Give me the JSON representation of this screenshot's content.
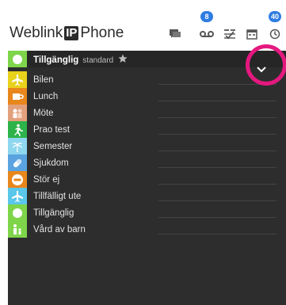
{
  "app": {
    "brand_prefix": "Weblink",
    "brand_ip": "IP",
    "brand_suffix": "Phone"
  },
  "header": {
    "icons": [
      {
        "name": "chat-icon",
        "badge": ""
      },
      {
        "name": "voicemail-icon",
        "badge": "8"
      },
      {
        "name": "call-log-icon",
        "badge": ""
      },
      {
        "name": "calendar-icon",
        "badge": ""
      },
      {
        "name": "clock-icon",
        "badge": "40"
      }
    ]
  },
  "status": {
    "current_label": "Tillgänglig",
    "current_sub": "standard",
    "items": [
      {
        "label": "Bilen",
        "color": "#e8d21c",
        "icon": "airplane-icon"
      },
      {
        "label": "Lunch",
        "color": "#e8871c",
        "icon": "coffee-cup-icon"
      },
      {
        "label": "Möte",
        "color": "#e2a17c",
        "icon": "people-icon"
      },
      {
        "label": "Prao test",
        "color": "#2cb34a",
        "icon": "running-person-icon"
      },
      {
        "label": "Semester",
        "color": "#8fd6ef",
        "icon": "palm-tree-icon"
      },
      {
        "label": "Sjukdom",
        "color": "#5aa3e0",
        "icon": "pill-icon"
      },
      {
        "label": "Stör ej",
        "color": "#e8871c",
        "icon": "no-entry-icon"
      },
      {
        "label": "Tillfälligt ute",
        "color": "#5ac6ea",
        "icon": "airplane-icon"
      },
      {
        "label": "Tillgänglig",
        "color": "#7ed54a",
        "icon": "circle-icon"
      },
      {
        "label": "Vård av barn",
        "color": "#7ed54a",
        "icon": "parent-child-icon"
      }
    ]
  },
  "colors": {
    "panel_bg": "#2d2d2d",
    "available_green": "#7ed54a",
    "badge_blue": "#2f7de1",
    "highlight_ring": "#e5187f"
  }
}
